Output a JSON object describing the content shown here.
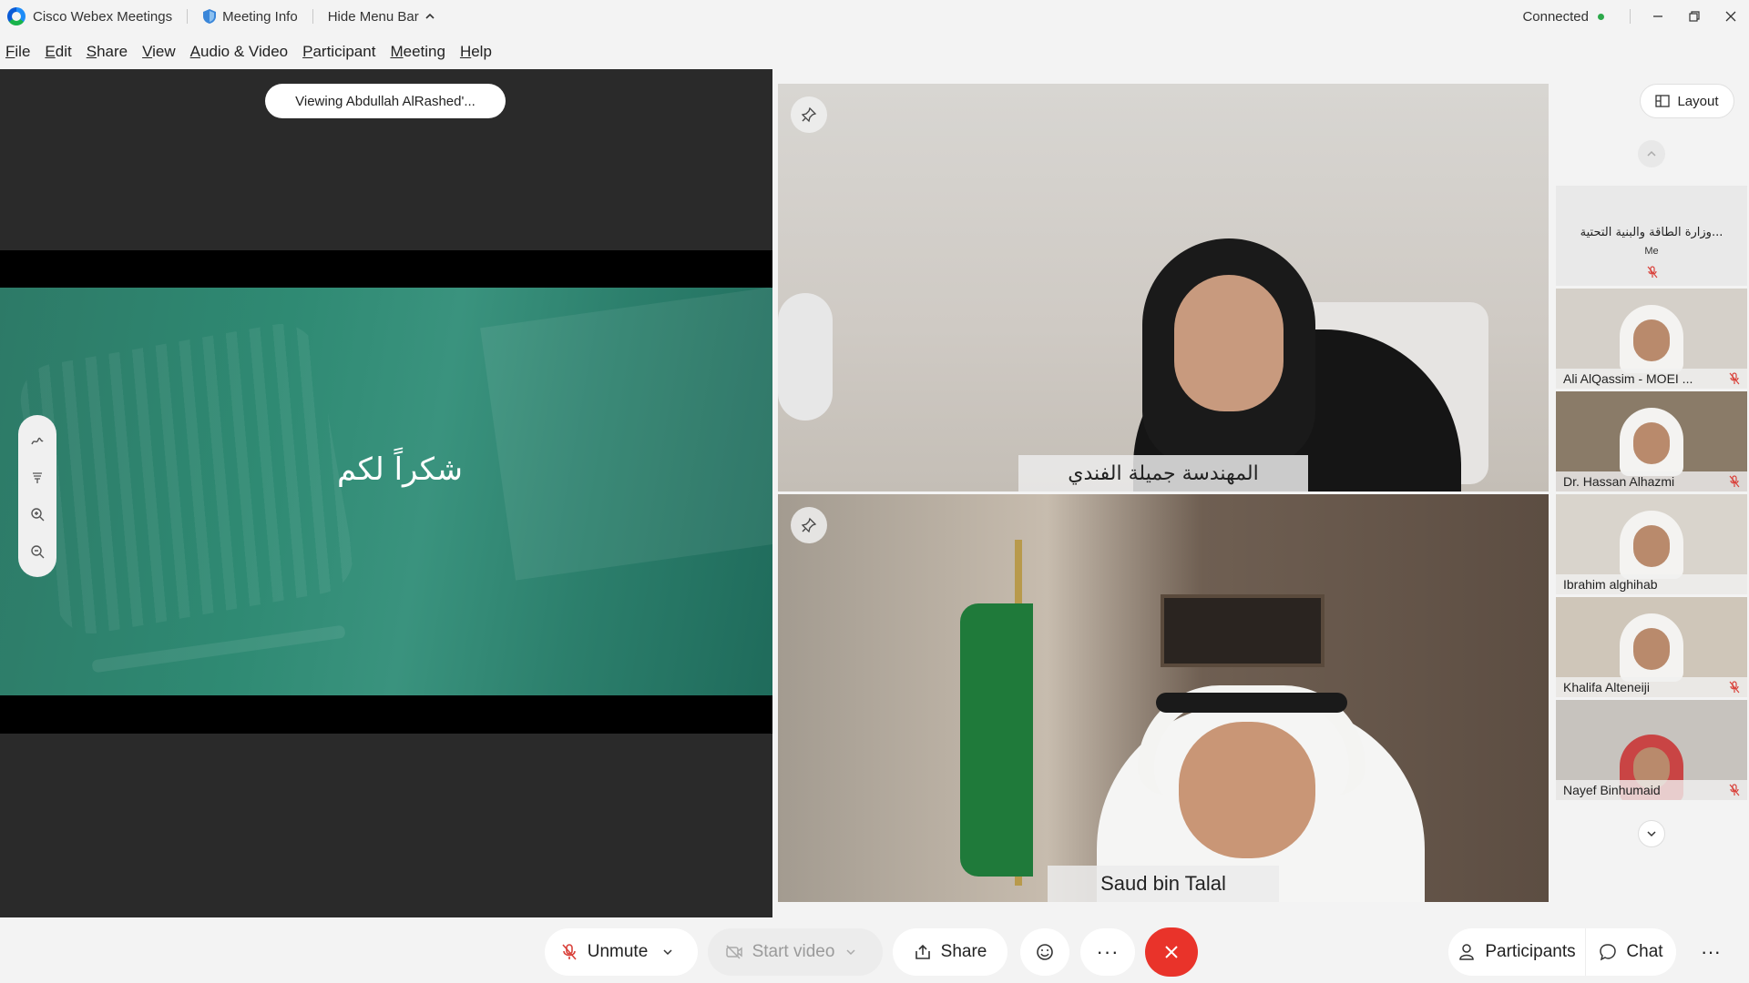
{
  "titlebar": {
    "app_name": "Cisco Webex Meetings",
    "meeting_info": "Meeting Info",
    "hide_menu": "Hide Menu Bar",
    "status": "Connected"
  },
  "menu": [
    {
      "key": "F",
      "rest": "ile"
    },
    {
      "key": "E",
      "rest": "dit"
    },
    {
      "key": "S",
      "rest": "hare"
    },
    {
      "key": "V",
      "rest": "iew"
    },
    {
      "key": "A",
      "rest": "udio & Video"
    },
    {
      "key": "P",
      "rest": "articipant"
    },
    {
      "key": "M",
      "rest": "eeting"
    },
    {
      "key": "H",
      "rest": "elp"
    }
  ],
  "share": {
    "viewing_label": "Viewing Abdullah AlRashed'...",
    "slide_text": "شكراً لكم"
  },
  "videos": [
    {
      "name": "المهندسة جميلة الفندي"
    },
    {
      "name": "Saud bin Talal"
    }
  ],
  "sidebar": {
    "layout_label": "Layout",
    "me": {
      "name": "وزارة الطاقة والبنية التحتية...",
      "sub": "Me"
    },
    "participants": [
      {
        "name": "Ali AlQassim - MOEI ..."
      },
      {
        "name": "Dr. Hassan Alhazmi"
      },
      {
        "name": "Ibrahim alghihab"
      },
      {
        "name": "Khalifa Alteneiji"
      },
      {
        "name": "Nayef Binhumaid"
      }
    ]
  },
  "controls": {
    "unmute": "Unmute",
    "start_video": "Start video",
    "share": "Share",
    "more": "···",
    "participants": "Participants",
    "chat": "Chat",
    "more_right": "···"
  },
  "colors": {
    "end_call": "#e9332a",
    "muted_mic": "#d9413a",
    "connected": "#2ca84a",
    "slide_green": "#2f8a73"
  },
  "icons": [
    "webex-logo-icon",
    "shield-icon",
    "chevron-up-icon",
    "minimize-icon",
    "restore-icon",
    "close-icon",
    "pen-icon",
    "pointer-icon",
    "zoom-in-icon",
    "zoom-out-icon",
    "pin-icon",
    "layout-icon",
    "mic-muted-icon",
    "video-off-icon",
    "share-icon",
    "emoji-icon",
    "end-call-icon",
    "person-icon",
    "chat-icon"
  ]
}
